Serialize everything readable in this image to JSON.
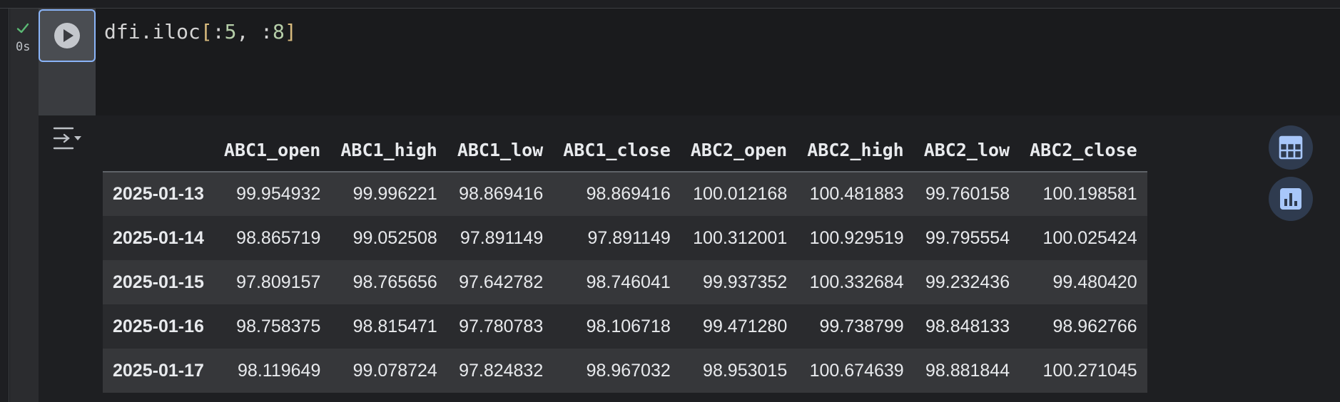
{
  "cell": {
    "status_icon": "check-icon",
    "exec_time": "0s",
    "run_icon": "play-icon",
    "code": {
      "var": "dfi.iloc",
      "open_bracket": "[",
      "slice1_colon": ":",
      "slice1_num": "5",
      "sep": ", ",
      "slice2_colon": ":",
      "slice2_num": "8",
      "close_bracket": "]"
    }
  },
  "output": {
    "toggle_icon": "output-toggle-icon",
    "table": {
      "columns": [
        "ABC1_open",
        "ABC1_high",
        "ABC1_low",
        "ABC1_close",
        "ABC2_open",
        "ABC2_high",
        "ABC2_low",
        "ABC2_close"
      ],
      "rows": [
        {
          "index": "2025-01-13",
          "values": [
            "99.954932",
            "99.996221",
            "98.869416",
            "98.869416",
            "100.012168",
            "100.481883",
            "99.760158",
            "100.198581"
          ]
        },
        {
          "index": "2025-01-14",
          "values": [
            "98.865719",
            "99.052508",
            "97.891149",
            "97.891149",
            "100.312001",
            "100.929519",
            "99.795554",
            "100.025424"
          ]
        },
        {
          "index": "2025-01-15",
          "values": [
            "97.809157",
            "98.765656",
            "97.642782",
            "98.746041",
            "99.937352",
            "100.332684",
            "99.232436",
            "99.480420"
          ]
        },
        {
          "index": "2025-01-16",
          "values": [
            "98.758375",
            "98.815471",
            "97.780783",
            "98.106718",
            "99.471280",
            "99.738799",
            "98.848133",
            "98.962766"
          ]
        },
        {
          "index": "2025-01-17",
          "values": [
            "98.119649",
            "99.078724",
            "97.824832",
            "98.967032",
            "98.953015",
            "100.674639",
            "98.881844",
            "100.271045"
          ]
        }
      ]
    },
    "side_buttons": {
      "table_icon": "table-icon",
      "chart_icon": "bar-chart-icon"
    }
  },
  "colors": {
    "accent": "#8ab4f8",
    "success": "#5bb974",
    "background": "#1e1f22"
  }
}
